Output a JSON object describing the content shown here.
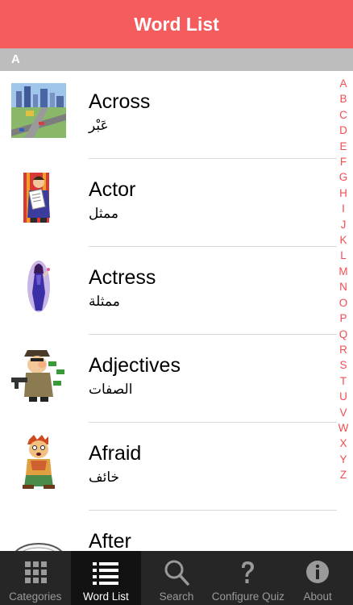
{
  "navbar": {
    "title": "Word List"
  },
  "section": {
    "header": "A"
  },
  "words": [
    {
      "english": "Across",
      "arabic": "عَبْر",
      "image": "city-highway-icon"
    },
    {
      "english": "Actor",
      "arabic": "ممثل",
      "image": "actor-reading-script-icon"
    },
    {
      "english": "Actress",
      "arabic": "ممثلة",
      "image": "actress-icon"
    },
    {
      "english": "Adjectives",
      "arabic": "الصفات",
      "image": "gangster-with-money-icon"
    },
    {
      "english": "Afraid",
      "arabic": "خائف",
      "image": "scared-man-icon"
    },
    {
      "english": "After",
      "arabic": "",
      "image": "clock-icon"
    }
  ],
  "index_letters": [
    "A",
    "B",
    "C",
    "D",
    "E",
    "F",
    "G",
    "H",
    "I",
    "J",
    "K",
    "L",
    "M",
    "N",
    "O",
    "P",
    "Q",
    "R",
    "S",
    "T",
    "U",
    "V",
    "W",
    "X",
    "Y",
    "Z"
  ],
  "tabs": [
    {
      "label": "Categories",
      "icon": "grid-icon",
      "active": false
    },
    {
      "label": "Word List",
      "icon": "list-icon",
      "active": true
    },
    {
      "label": "Search",
      "icon": "magnifier-icon",
      "active": false
    },
    {
      "label": "Configure Quiz",
      "icon": "question-mark-icon",
      "active": false
    },
    {
      "label": "About",
      "icon": "info-icon",
      "active": false
    }
  ],
  "colors": {
    "accent": "#f45c5e",
    "index_letter": "#f04e52",
    "section_header": "#bdbdbd",
    "tabbar": "#262626"
  }
}
